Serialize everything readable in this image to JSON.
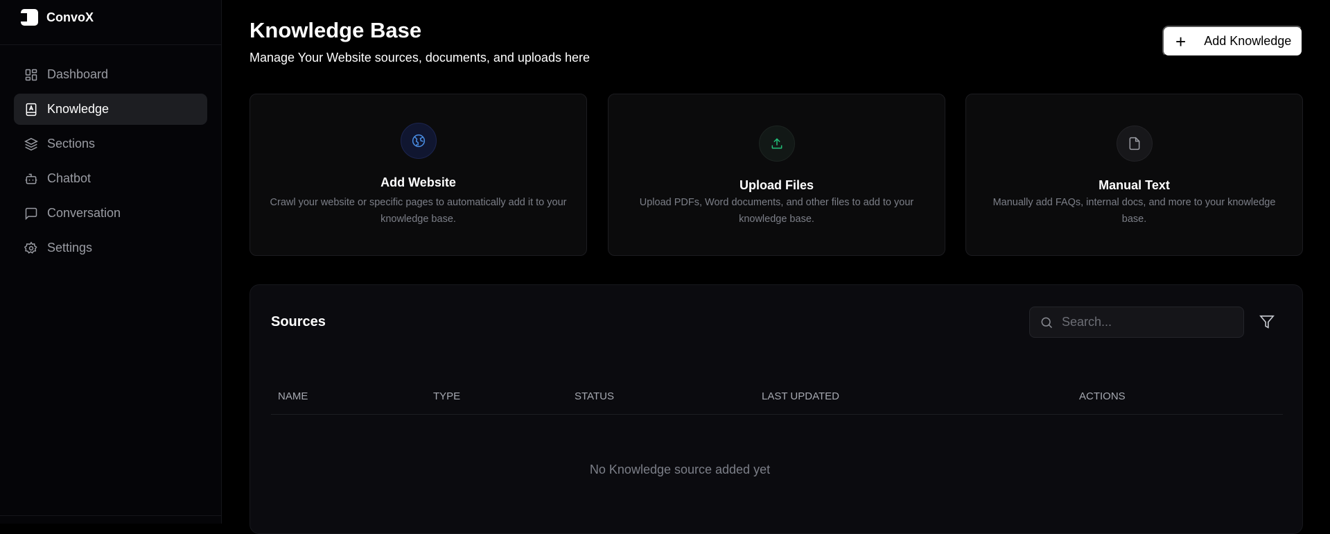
{
  "app": {
    "name": "ConvoX"
  },
  "sidebar": {
    "items": [
      {
        "label": "Dashboard",
        "icon": "dashboard-icon"
      },
      {
        "label": "Knowledge",
        "icon": "book-icon",
        "active": true
      },
      {
        "label": "Sections",
        "icon": "layers-icon"
      },
      {
        "label": "Chatbot",
        "icon": "bot-icon"
      },
      {
        "label": "Conversation",
        "icon": "message-icon"
      },
      {
        "label": "Settings",
        "icon": "gear-icon"
      }
    ]
  },
  "header": {
    "title": "Knowledge Base",
    "subtitle": "Manage Your Website sources, documents, and uploads here",
    "add_button": "Add Knowledge",
    "add_icon": "+"
  },
  "cards": [
    {
      "title": "Add Website",
      "description": "Crawl your website or specific pages to automatically add it to your knowledge base.",
      "icon": "globe-icon",
      "color": "#4a8fe6"
    },
    {
      "title": "Upload Files",
      "description": "Upload PDFs, Word documents, and other files to add to your knowledge base.",
      "icon": "upload-icon",
      "color": "#22c07a"
    },
    {
      "title": "Manual Text",
      "description": "Manually add FAQs, internal docs, and more to your knowledge base.",
      "icon": "file-icon",
      "color": "#9a9ca3"
    }
  ],
  "sources": {
    "title": "Sources",
    "search_placeholder": "Search...",
    "columns": [
      "NAME",
      "TYPE",
      "STATUS",
      "LAST UPDATED",
      "ACTIONS"
    ],
    "empty_text": "No Knowledge source added yet"
  }
}
